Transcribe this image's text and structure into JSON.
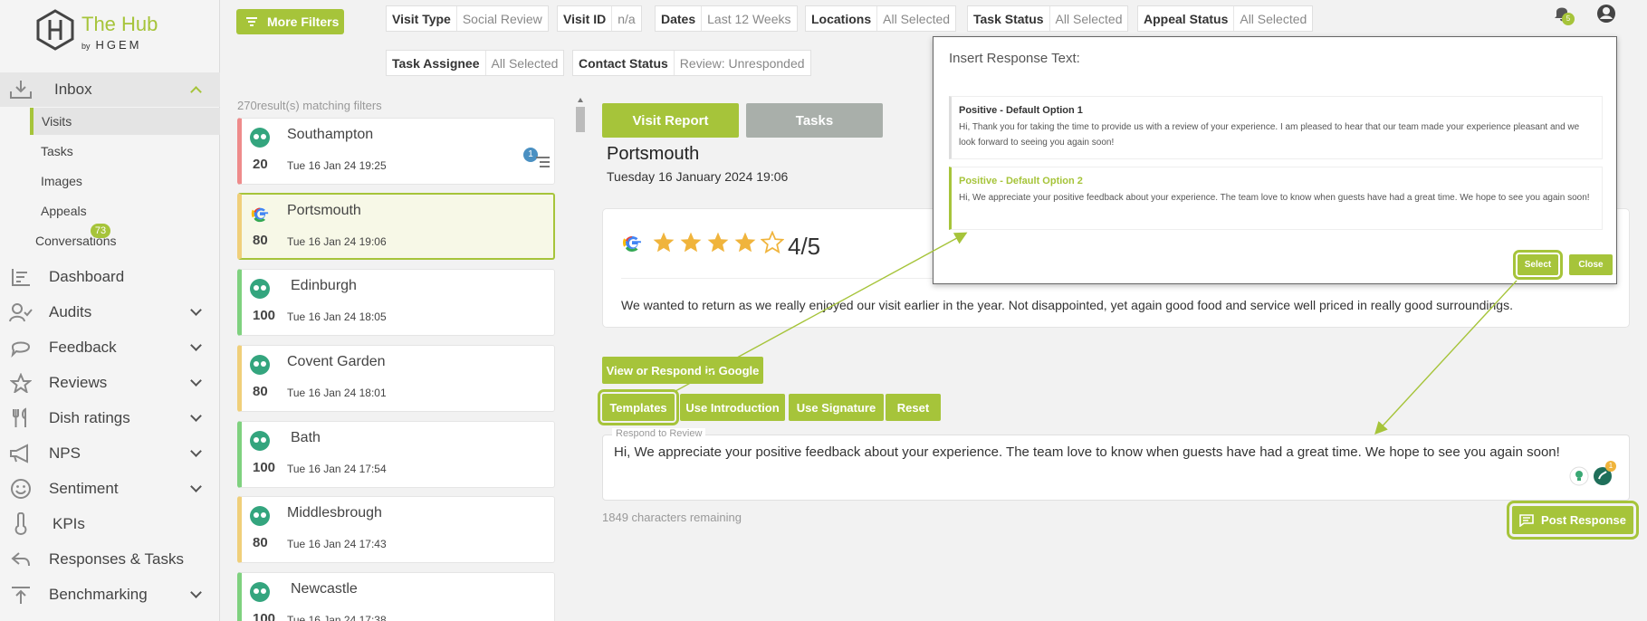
{
  "brand": {
    "name": "The Hub",
    "by": "by",
    "company": "HGEM"
  },
  "sidebar": {
    "inbox": "Inbox",
    "inbox_sub": [
      "Visits",
      "Tasks",
      "Images",
      "Appeals",
      "Conversations"
    ],
    "conversations_badge": "73",
    "items": [
      "Dashboard",
      "Audits",
      "Feedback",
      "Reviews",
      "Dish ratings",
      "NPS",
      "Sentiment",
      "KPIs",
      "Responses & Tasks",
      "Benchmarking"
    ]
  },
  "filters": {
    "more": "More Filters",
    "row1": [
      {
        "k": "Visit Type",
        "v": "Social Review"
      },
      {
        "k": "Visit ID",
        "v": "n/a"
      },
      {
        "k": "Dates",
        "v": "Last 12 Weeks"
      },
      {
        "k": "Locations",
        "v": "All Selected"
      },
      {
        "k": "Task Status",
        "v": "All Selected"
      },
      {
        "k": "Appeal Status",
        "v": "All Selected"
      }
    ],
    "row2": [
      {
        "k": "Task Assignee",
        "v": "All Selected"
      },
      {
        "k": "Contact Status",
        "v": "Review: Unresponded"
      }
    ]
  },
  "notif_count": "5",
  "results": {
    "count": "270",
    "text": "result(s) matching filters"
  },
  "visits": [
    {
      "name": "Southampton",
      "score": "20",
      "date": "Tue 16 Jan 24 19:25",
      "badge": "1",
      "source": "tripadvisor"
    },
    {
      "name": "Portsmouth",
      "score": "80",
      "date": "Tue 16 Jan 24 19:06",
      "source": "google"
    },
    {
      "name": "Edinburgh",
      "score": "100",
      "date": "Tue 16 Jan 24 18:05",
      "source": "tripadvisor"
    },
    {
      "name": "Covent Garden",
      "score": "80",
      "date": "Tue 16 Jan 24 18:01",
      "source": "tripadvisor"
    },
    {
      "name": "Bath",
      "score": "100",
      "date": "Tue 16 Jan 24 17:54",
      "source": "tripadvisor"
    },
    {
      "name": "Middlesbrough",
      "score": "80",
      "date": "Tue 16 Jan 24 17:43",
      "source": "tripadvisor"
    },
    {
      "name": "Newcastle",
      "score": "100",
      "date": "Tue 16 Jan 24 17:38",
      "source": "tripadvisor"
    }
  ],
  "colors": {
    "accent": "#a6c43a",
    "red": "#ee8b8b",
    "amber": "#f0cf7a",
    "green": "#7fd17f"
  },
  "detail": {
    "tabs": [
      "Visit Report",
      "Tasks"
    ],
    "location": "Portsmouth",
    "date": "Tuesday 16 January 2024 19:06",
    "rating": "4/5",
    "rating_value": 4,
    "rating_max": 5,
    "review": "We wanted to return as we really enjoyed our visit earlier in the year. Not disappointed, yet again good food and service well priced in really good surroundings.",
    "google_btn": "View or Respond in Google",
    "templates": "Templates",
    "intro": "Use Introduction",
    "signature": "Use Signature",
    "reset": "Reset",
    "respond_label": "Respond to Review",
    "response": "Hi, We appreciate your positive feedback about your experience. The team love to know when guests have had a great time. We hope to see you again soon!",
    "assist_count": "1",
    "chars": "1849 characters remaining",
    "post": "Post Response"
  },
  "popup": {
    "title": "Insert Response Text:",
    "options": [
      {
        "title": "Positive - Default Option 1",
        "body": "Hi, Thank you for taking the time to provide us with a review of your experience. I am pleased to hear that our team made your experience pleasant and we look forward to seeing you again soon!"
      },
      {
        "title": "Positive - Default Option 2",
        "body": "Hi, We appreciate your positive feedback about your experience. The team love to know when guests have had a great time. We hope to see you again soon!"
      }
    ],
    "select": "Select",
    "close": "Close"
  }
}
